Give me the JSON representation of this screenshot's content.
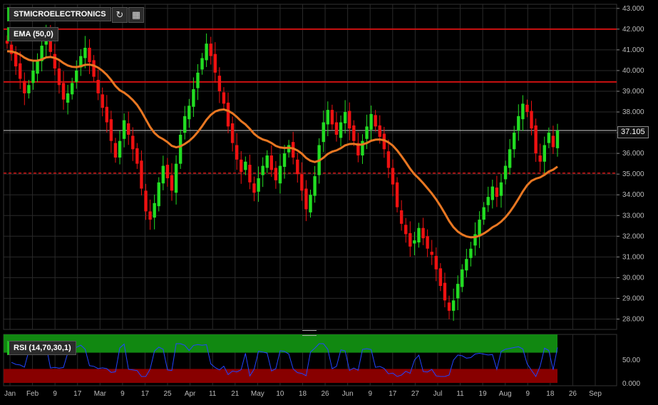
{
  "symbol": "STMICROELECTRONICS",
  "indicators": {
    "ema_label": "EMA (50,0)",
    "rsi_label": "RSI (14,70,30,1)"
  },
  "toolbar": {
    "refresh_icon": "refresh-icon",
    "calendar_icon": "calendar-icon"
  },
  "last_price": "37.105",
  "colors": {
    "up": "#22dd22",
    "down": "#ee1111",
    "ema": "#e87722",
    "hline": "#cc1111",
    "rsi_line": "#2244ff",
    "rsi_overbought": "#118811",
    "rsi_oversold": "#880000"
  },
  "chart_data": [
    {
      "type": "candlestick",
      "title": "STMICROELECTRONICS",
      "ylim": [
        27.5,
        43.2
      ],
      "yticks": [
        "43.000",
        "42.000",
        "41.000",
        "40.000",
        "39.000",
        "38.000",
        "37.000",
        "36.000",
        "35.000",
        "34.000",
        "33.000",
        "32.000",
        "31.000",
        "30.000",
        "29.000",
        "28.000"
      ],
      "xticks": [
        "Jan",
        "Feb",
        "9",
        "17",
        "Mar",
        "9",
        "17",
        "25",
        "Apr",
        "11",
        "21",
        "May",
        "10",
        "18",
        "26",
        "Jun",
        "9",
        "17",
        "27",
        "Jul",
        "11",
        "19",
        "Aug",
        "9",
        "18",
        "26",
        "Sep"
      ],
      "horizontal_lines": [
        42.0,
        39.45
      ],
      "dashed_line": 35.05,
      "last_price": 37.105,
      "closes": [
        41.3,
        40.8,
        40.2,
        39.6,
        38.9,
        39.3,
        40.0,
        40.5,
        41.2,
        41.8,
        40.9,
        40.1,
        39.3,
        38.6,
        38.9,
        39.4,
        40.0,
        40.7,
        41.1,
        40.4,
        39.7,
        38.9,
        38.2,
        37.5,
        36.6,
        35.8,
        36.6,
        37.6,
        36.9,
        36.2,
        35.5,
        34.3,
        33.2,
        32.8,
        33.6,
        34.6,
        35.4,
        34.8,
        34.2,
        35.5,
        36.9,
        37.8,
        38.3,
        39.1,
        39.9,
        40.6,
        41.3,
        40.7,
        39.9,
        39.0,
        38.4,
        37.3,
        36.5,
        35.7,
        35.1,
        35.6,
        34.6,
        34.1,
        34.8,
        35.4,
        35.9,
        35.2,
        34.7,
        35.4,
        36.0,
        36.4,
        35.8,
        35.0,
        34.2,
        33.3,
        34.0,
        34.9,
        36.4,
        37.5,
        38.1,
        37.4,
        36.9,
        37.5,
        38.0,
        37.2,
        36.6,
        35.9,
        36.6,
        37.3,
        37.9,
        37.3,
        36.8,
        36.2,
        35.3,
        34.5,
        33.4,
        32.6,
        32.1,
        31.5,
        31.8,
        32.4,
        31.9,
        31.4,
        31.1,
        30.4,
        29.6,
        28.9,
        28.4,
        28.9,
        29.7,
        30.4,
        30.9,
        31.4,
        32.1,
        32.8,
        33.4,
        33.9,
        34.4,
        33.9,
        34.6,
        35.4,
        36.2,
        37.0,
        37.8,
        38.4,
        38.0,
        37.2,
        36.0,
        35.6,
        36.4,
        37.0,
        36.3,
        37.1
      ],
      "ema50_range": [
        40.9,
        33.0
      ],
      "rsi": {
        "ylim": [
          0,
          100
        ],
        "yticks": [
          "50.00",
          "0.000"
        ],
        "overbought": 70,
        "oversold": 30
      }
    }
  ]
}
